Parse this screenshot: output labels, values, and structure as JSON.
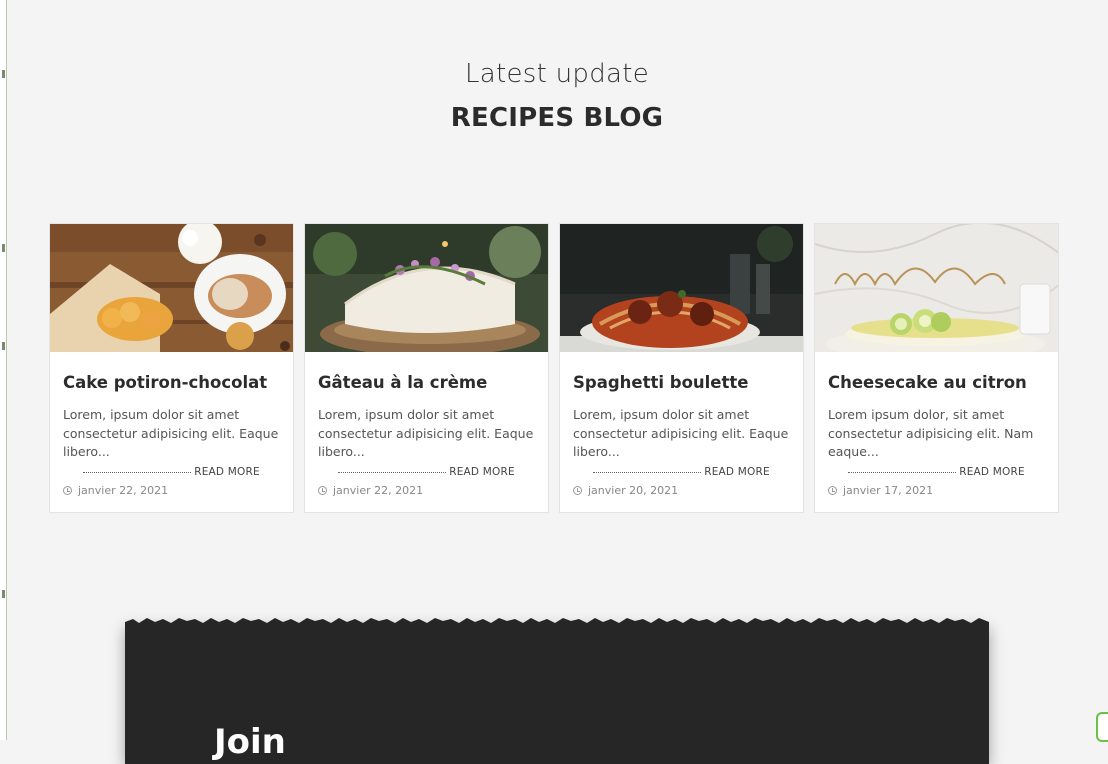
{
  "section": {
    "kicker": "Latest update",
    "title": "RECIPES BLOG"
  },
  "posts": [
    {
      "title": "Cake potiron-chocolat",
      "excerpt": "Lorem, ipsum dolor sit amet consectetur adipisicing elit. Eaque libero...",
      "read_more": "READ MORE",
      "date": "janvier 22, 2021"
    },
    {
      "title": "Gâteau à la crème",
      "excerpt": "Lorem, ipsum dolor sit amet consectetur adipisicing elit. Eaque libero...",
      "read_more": "READ MORE",
      "date": "janvier 22, 2021"
    },
    {
      "title": "Spaghetti boulette",
      "excerpt": "Lorem, ipsum dolor sit amet consectetur adipisicing elit. Eaque libero...",
      "read_more": "READ MORE",
      "date": "janvier 20, 2021"
    },
    {
      "title": "Cheesecake au citron",
      "excerpt": "Lorem ipsum dolor, sit amet consectetur adipisicing elit. Nam eaque...",
      "read_more": "READ MORE",
      "date": "janvier 17, 2021"
    }
  ],
  "join": {
    "title": "Join"
  },
  "colors": {
    "page_bg": "#f4f4f4",
    "card_bg": "#ffffff",
    "panel_bg": "#262626",
    "badge_accent": "#6cc04a"
  }
}
